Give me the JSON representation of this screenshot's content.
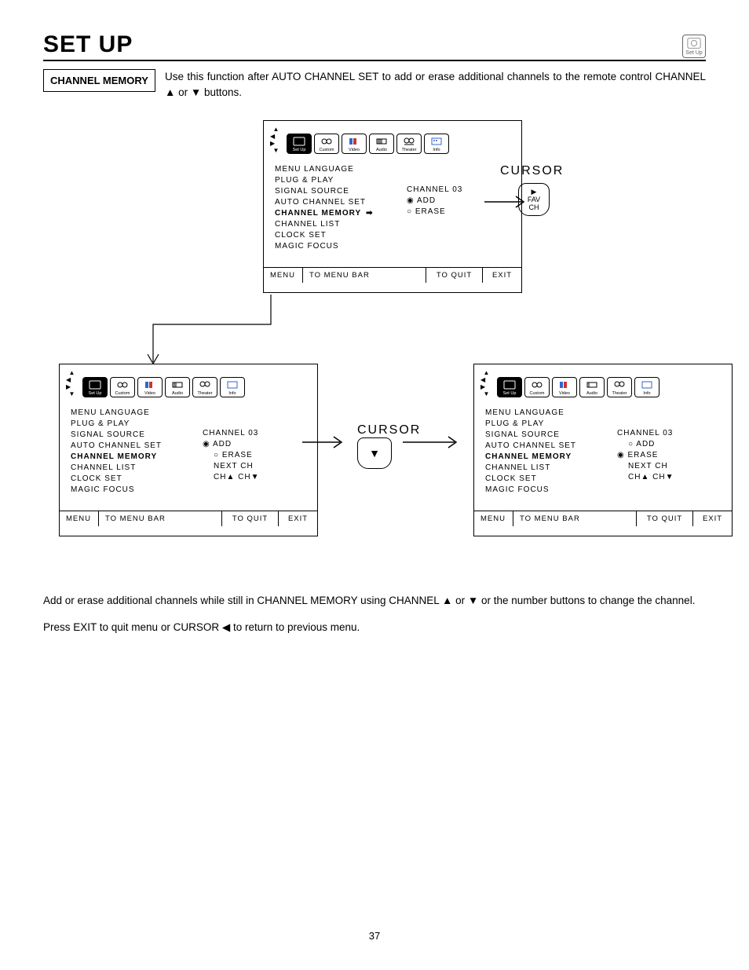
{
  "header": {
    "title": "SET UP",
    "icon_label": "Set Up"
  },
  "section": {
    "label": "CHANNEL MEMORY",
    "intro_pre": "Use this function after AUTO CHANNEL SET to add or erase additional channels to the remote control CHANNEL ",
    "intro_mid_a": " or ",
    "intro_post": " buttons."
  },
  "tabs": [
    "Set Up",
    "Custom",
    "Video",
    "Audio",
    "Theater",
    "Info"
  ],
  "menu_items": [
    "MENU LANGUAGE",
    "PLUG & PLAY",
    "SIGNAL SOURCE",
    "AUTO CHANNEL SET",
    "CHANNEL MEMORY",
    "CHANNEL LIST",
    "CLOCK SET",
    "MAGIC FOCUS"
  ],
  "osd_top": {
    "channel": "CHANNEL  03",
    "add": "ADD",
    "erase": "ERASE"
  },
  "osd_bl": {
    "channel": "CHANNEL  03",
    "add": "ADD",
    "erase": "ERASE",
    "nextch": "NEXT CH",
    "chnav": "CH▲  CH▼"
  },
  "osd_br": {
    "channel": "CHANNEL  03",
    "add": "ADD",
    "erase": "ERASE",
    "nextch": "NEXT CH",
    "chnav": "CH▲  CH▼"
  },
  "footer": {
    "menu": "MENU",
    "tobar": "TO MENU BAR",
    "toquit": "TO QUIT",
    "exit": "EXIT"
  },
  "cursor_label": "CURSOR",
  "fav": {
    "l1": "▶",
    "l2": "FAV",
    "l3": "CH"
  },
  "para1_pre": "Add or erase additional channels while still in CHANNEL MEMORY using CHANNEL ",
  "para1_mid": " or ",
  "para1_post": " or the number buttons to change the channel.",
  "para2_pre": "Press EXIT to quit menu or CURSOR ",
  "para2_post": " to return to previous menu.",
  "page": "37"
}
